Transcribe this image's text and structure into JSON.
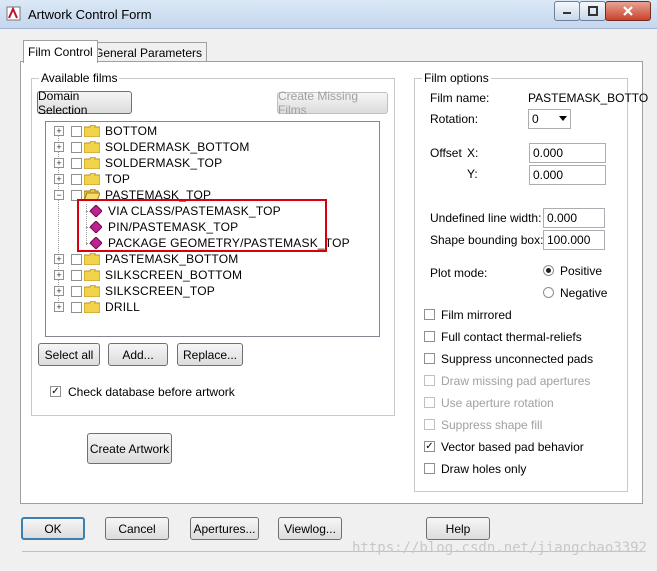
{
  "window": {
    "title": "Artwork Control Form"
  },
  "tabs": [
    {
      "label": "Film Control"
    },
    {
      "label": "General Parameters"
    }
  ],
  "available_films": {
    "group_label": "Available films",
    "domain_selection": "Domain Selection",
    "create_missing": "Create Missing Films",
    "tree": [
      {
        "label": "BOTTOM",
        "type": "folder"
      },
      {
        "label": "SOLDERMASK_BOTTOM",
        "type": "folder"
      },
      {
        "label": "SOLDERMASK_TOP",
        "type": "folder"
      },
      {
        "label": "TOP",
        "type": "folder"
      },
      {
        "label": "PASTEMASK_TOP",
        "type": "folder-open"
      },
      {
        "label": "VIA CLASS/PASTEMASK_TOP",
        "type": "item"
      },
      {
        "label": "PIN/PASTEMASK_TOP",
        "type": "item"
      },
      {
        "label": "PACKAGE GEOMETRY/PASTEMASK_TOP",
        "type": "item"
      },
      {
        "label": "PASTEMASK_BOTTOM",
        "type": "folder"
      },
      {
        "label": "SILKSCREEN_BOTTOM",
        "type": "folder"
      },
      {
        "label": "SILKSCREEN_TOP",
        "type": "folder"
      },
      {
        "label": "DRILL",
        "type": "folder"
      }
    ],
    "select_all": "Select all",
    "add": "Add...",
    "replace": "Replace...",
    "check_db": "Check database before artwork",
    "create_artwork": "Create Artwork"
  },
  "film_options": {
    "group_label": "Film options",
    "film_name_label": "Film name:",
    "film_name_value": "PASTEMASK_BOTTO",
    "rotation_label": "Rotation:",
    "rotation_value": "0",
    "offset_label": "Offset",
    "x_label": "X:",
    "x_value": "0.000",
    "y_label": "Y:",
    "y_value": "0.000",
    "undef_line_label": "Undefined line width:",
    "undef_line_value": "0.000",
    "shape_bound_label": "Shape bounding box:",
    "shape_bound_value": "100.000",
    "plot_mode_label": "Plot mode:",
    "positive": "Positive",
    "negative": "Negative",
    "options": [
      {
        "label": "Film mirrored",
        "checked": false,
        "enabled": true
      },
      {
        "label": "Full contact thermal-reliefs",
        "checked": false,
        "enabled": true
      },
      {
        "label": "Suppress unconnected pads",
        "checked": false,
        "enabled": true
      },
      {
        "label": "Draw missing pad apertures",
        "checked": false,
        "enabled": false
      },
      {
        "label": "Use aperture rotation",
        "checked": false,
        "enabled": false
      },
      {
        "label": "Suppress shape fill",
        "checked": false,
        "enabled": false
      },
      {
        "label": "Vector based pad behavior",
        "checked": true,
        "enabled": true
      },
      {
        "label": "Draw holes only",
        "checked": false,
        "enabled": true
      }
    ]
  },
  "bottom_buttons": {
    "ok": "OK",
    "cancel": "Cancel",
    "apertures": "Apertures...",
    "viewlog": "Viewlog...",
    "help": "Help"
  },
  "watermark": "https://blog.csdn.net/jiangchao3392",
  "colors": {
    "highlight_box": "#d9000d",
    "item_icon": "#c02090",
    "folder": "#f3d34a"
  }
}
